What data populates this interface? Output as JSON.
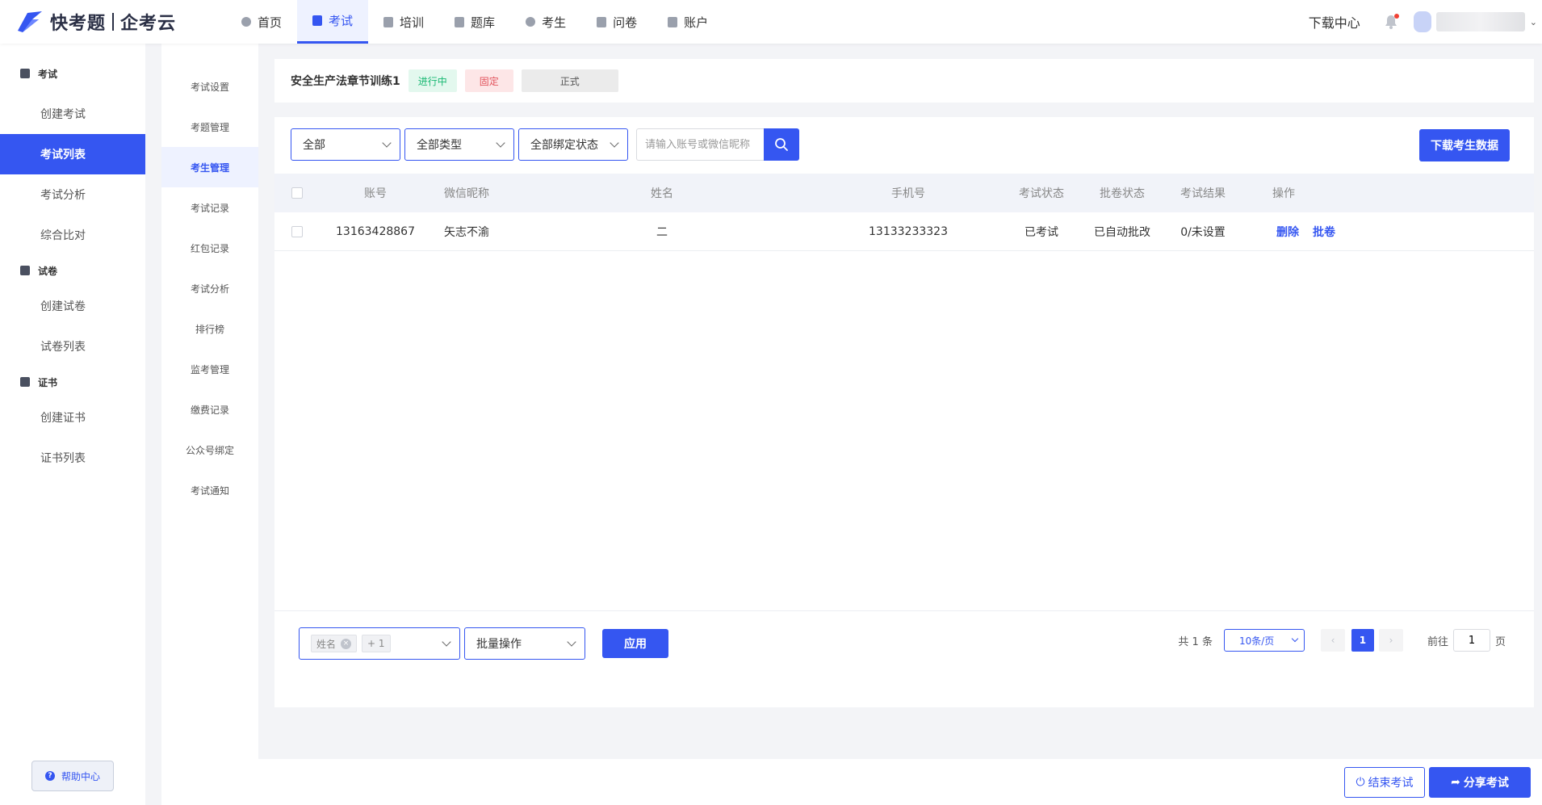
{
  "brand": {
    "name_a": "快考题",
    "name_b": "企考云"
  },
  "nav": {
    "items": [
      {
        "label": "首页",
        "icon": "home-icon"
      },
      {
        "label": "考试",
        "icon": "exam-icon",
        "active": true
      },
      {
        "label": "培训",
        "icon": "training-icon"
      },
      {
        "label": "题库",
        "icon": "question-bank-icon"
      },
      {
        "label": "考生",
        "icon": "user-icon"
      },
      {
        "label": "问卷",
        "icon": "survey-icon"
      },
      {
        "label": "账户",
        "icon": "account-icon"
      }
    ],
    "download_center": "下载中心"
  },
  "sidebar": {
    "groups": [
      {
        "title": "考试",
        "items": [
          "创建考试",
          "考试列表",
          "考试分析",
          "综合比对"
        ]
      },
      {
        "title": "试卷",
        "items": [
          "创建试卷",
          "试卷列表"
        ]
      },
      {
        "title": "证书",
        "items": [
          "创建证书",
          "证书列表"
        ]
      }
    ],
    "active_item": "考试列表",
    "help_label": "帮助中心"
  },
  "subnav": {
    "items": [
      "考试设置",
      "考题管理",
      "考生管理",
      "考试记录",
      "红包记录",
      "考试分析",
      "排行榜",
      "监考管理",
      "缴费记录",
      "公众号绑定",
      "考试通知"
    ],
    "active_item": "考生管理"
  },
  "exam": {
    "title": "安全生产法章节训练1",
    "status_tag": "进行中",
    "mode_tag": "固定",
    "type_tag": "正式"
  },
  "filters": {
    "scope": "全部",
    "type": "全部类型",
    "binding": "全部绑定状态",
    "search_placeholder": "请输入账号或微信昵称",
    "download_button": "下载考生数据"
  },
  "table": {
    "headers": {
      "account": "账号",
      "nickname": "微信昵称",
      "name": "姓名",
      "phone": "手机号",
      "exam_status": "考试状态",
      "grading_status": "批卷状态",
      "result": "考试结果",
      "actions": "操作"
    },
    "rows": [
      {
        "account": "13163428867",
        "nickname": "矢志不渝",
        "name": "二",
        "phone": "13133233323",
        "exam_status": "已考试",
        "grading_status": "已自动批改",
        "result": "0/未设置",
        "delete": "删除",
        "grade": "批卷"
      }
    ]
  },
  "bulk": {
    "field_chip": "姓名",
    "extra_chip": "+ 1",
    "action_select": "批量操作",
    "apply": "应用"
  },
  "pagination": {
    "total": "共 1 条",
    "page_size": "10条/页",
    "current_page": "1",
    "goto_prefix": "前往",
    "goto_value": "1",
    "goto_suffix": "页"
  },
  "footer": {
    "end_exam": "结束考试",
    "share_exam": "分享考试"
  },
  "colors": {
    "accent": "#3556f1",
    "success": "#19b873",
    "danger": "#e2535c"
  }
}
